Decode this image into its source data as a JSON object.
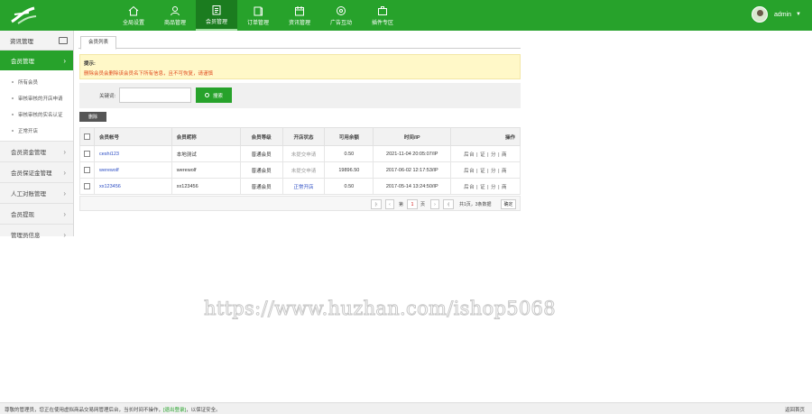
{
  "header": {
    "nav": [
      {
        "label": "全局设置",
        "icon": "home-icon"
      },
      {
        "label": "商品管理",
        "icon": "user-icon"
      },
      {
        "label": "会员管理",
        "icon": "clipboard-icon",
        "active": true
      },
      {
        "label": "订单管理",
        "icon": "book-icon"
      },
      {
        "label": "资讯管理",
        "icon": "calendar-icon"
      },
      {
        "label": "广告互动",
        "icon": "chart-icon"
      },
      {
        "label": "插件专区",
        "icon": "briefcase-icon"
      }
    ],
    "user": {
      "name": "admin",
      "caret": "▼"
    }
  },
  "sidebar": {
    "title": "资讯管理",
    "active_section": "会员管理",
    "sub_items": [
      "所有会员",
      "审核审核的开店申请",
      "审核审核的实名认证",
      "正常开店"
    ],
    "sections": [
      "会员资金管理",
      "会员保证金管理",
      "人工对账管理",
      "会员提现",
      "管理员信息"
    ]
  },
  "main": {
    "tab": "会员列表",
    "notice": {
      "title": "提示:",
      "text": "删除会员会删除该会员名下所有信息，且不可恢复，请谨慎"
    },
    "search": {
      "label": "关键词:",
      "placeholder": "",
      "button": "搜索"
    },
    "delete_button": "删除",
    "table": {
      "headers": [
        "会员帐号",
        "会员昵称",
        "会员等级",
        "开店状态",
        "可用余额",
        "时间/IP",
        "操作"
      ],
      "rows": [
        {
          "account": "ceshi123",
          "nickname": "本地测试",
          "level": "普通会员",
          "status": "未提交申请",
          "balance": "0.50",
          "time": "2021-11-04 20:05:07/IP",
          "ops": "后台 | 证 | 分 | 商"
        },
        {
          "account": "werewolf",
          "nickname": "werewolf",
          "level": "普通会员",
          "status": "未提交申请",
          "balance": "19896.50",
          "time": "2017-06-02 12:17:53/IP",
          "ops": "后台 | 证 | 分 | 商"
        },
        {
          "account": "xx123456",
          "nickname": "xx123456",
          "level": "普通会员",
          "status": "正常开店",
          "balance": "0.50",
          "time": "2017-05-14 13:24:50/IP",
          "ops": "后台 | 证 | 分 | 商"
        }
      ]
    },
    "pager": {
      "first": "|‹",
      "prev": "‹",
      "page_prefix": "第",
      "page_value": "1",
      "page_suffix": "页",
      "next": "›",
      "last": "›|",
      "summary": "共1页，3条数据",
      "go": "确定"
    }
  },
  "watermark": "https://www.huzhan.com/ishop5068",
  "footer": {
    "message_prefix": "尊敬的管理员，您正在使用虚拟商品交易网管理后台，当长时间不操作，",
    "message_link": "[退出登录]",
    "message_suffix": "，以保证安全。",
    "back": "返回首页"
  },
  "colors": {
    "brand": "#27a22b",
    "notice_text": "#e04a1e",
    "link": "#2d4ec4"
  }
}
